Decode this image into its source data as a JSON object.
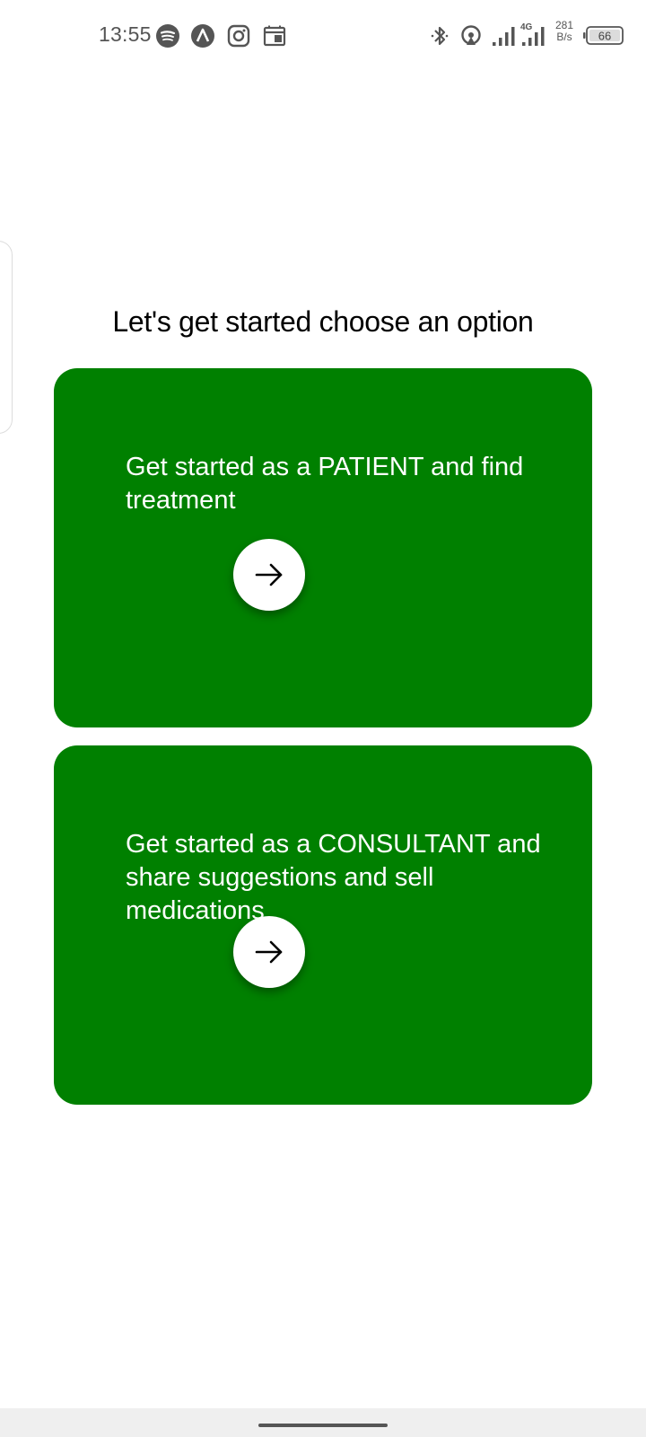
{
  "status_bar": {
    "time": "13:55",
    "left_icons": [
      "spotify-icon",
      "arc-app-icon",
      "instagram-icon",
      "calendar-app-icon"
    ],
    "right_icons": [
      "bluetooth-icon",
      "hotspot-icon",
      "signal-icon",
      "signal-4g-icon"
    ],
    "network_type": "4G",
    "net_speed_value": "281",
    "net_speed_unit": "B/s",
    "battery_level": "66"
  },
  "main": {
    "title": "Let's get started choose an option",
    "options": [
      {
        "text": "Get started as a PATIENT and find treatment",
        "button_icon": "arrow-right-icon"
      },
      {
        "text": "Get started as a CONSULTANT and share suggestions and sell medications",
        "button_icon": "arrow-right-icon"
      }
    ]
  },
  "colors": {
    "card_background": "#008000",
    "card_text": "#ffffff",
    "page_background": "#ffffff"
  }
}
